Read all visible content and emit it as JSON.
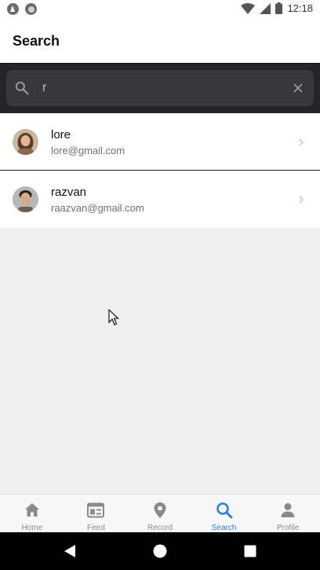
{
  "status_bar": {
    "time": "12:18",
    "left_icons": [
      "app-a-icon",
      "app-circle-icon"
    ],
    "right_icons": [
      "wifi-icon",
      "cellular-icon",
      "battery-icon"
    ]
  },
  "header": {
    "title": "Search"
  },
  "search": {
    "value": "r",
    "icon": "search-icon",
    "clear_icon": "close-icon"
  },
  "results": [
    {
      "name": "lore",
      "email": "lore@gmail.com",
      "avatar": "avatar-lore"
    },
    {
      "name": "razvan",
      "email": "raazvan@gmail.com",
      "avatar": "avatar-razvan"
    }
  ],
  "tabs": [
    {
      "label": "Home",
      "icon": "home-icon",
      "active": false
    },
    {
      "label": "Feed",
      "icon": "feed-icon",
      "active": false
    },
    {
      "label": "Record",
      "icon": "location-pin-icon",
      "active": false
    },
    {
      "label": "Search",
      "icon": "search-icon",
      "active": true
    },
    {
      "label": "Profile",
      "icon": "person-icon",
      "active": false
    }
  ],
  "colors": {
    "accent": "#2f7ee2",
    "inactive": "#8a8a8a",
    "toolbar_bg": "#232427",
    "search_field_bg": "#36383c",
    "caret": "#2bb3a4"
  }
}
